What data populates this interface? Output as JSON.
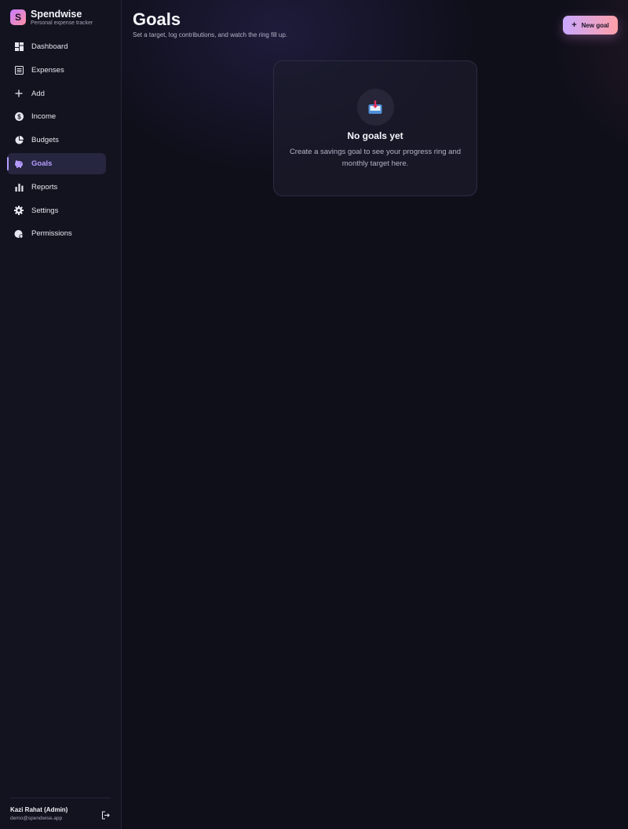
{
  "brand": {
    "logo_letter": "S",
    "name": "Spendwise",
    "tagline": "Personal expense tracker"
  },
  "sidebar": {
    "items": [
      {
        "label": "Dashboard",
        "icon": "dashboard-icon",
        "active": false
      },
      {
        "label": "Expenses",
        "icon": "list-icon",
        "active": false
      },
      {
        "label": "Add",
        "icon": "plus-icon",
        "active": false
      },
      {
        "label": "Income",
        "icon": "dollar-icon",
        "active": false
      },
      {
        "label": "Budgets",
        "icon": "pie-chart-icon",
        "active": false
      },
      {
        "label": "Goals",
        "icon": "piggy-bank-icon",
        "active": true
      },
      {
        "label": "Reports",
        "icon": "bar-chart-icon",
        "active": false
      },
      {
        "label": "Settings",
        "icon": "gear-icon",
        "active": false
      },
      {
        "label": "Permissions",
        "icon": "shield-icon",
        "active": false
      }
    ]
  },
  "user": {
    "name": "Kazi Rahat (Admin)",
    "email": "demo@spendwise.app"
  },
  "header": {
    "title": "Goals",
    "subtitle": "Set a target, log contributions, and watch the ring fill up.",
    "new_goal_label": "New goal"
  },
  "empty_state": {
    "icon": "inbox-tray-icon",
    "title": "No goals yet",
    "text": "Create a savings goal to see your progress ring and monthly target here."
  },
  "colors": {
    "accent": "#b69cff",
    "button_gradient_start": "#c9a8ff",
    "button_gradient_end": "#ff9fa8"
  }
}
